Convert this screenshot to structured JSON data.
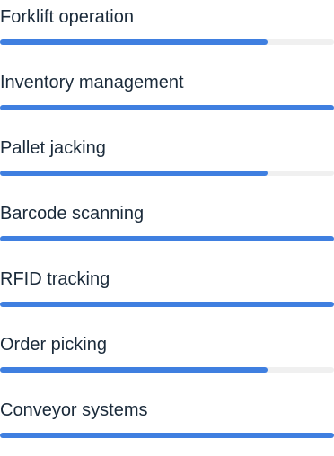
{
  "skills": [
    {
      "label": "Forklift operation",
      "level_percent": 80
    },
    {
      "label": "Inventory management",
      "level_percent": 100
    },
    {
      "label": "Pallet jacking",
      "level_percent": 80
    },
    {
      "label": "Barcode scanning",
      "level_percent": 100
    },
    {
      "label": "RFID tracking",
      "level_percent": 100
    },
    {
      "label": "Order picking",
      "level_percent": 80
    },
    {
      "label": "Conveyor systems",
      "level_percent": 100
    }
  ],
  "colors": {
    "fill": "#3f7fe0",
    "track": "#f0f0f0",
    "text": "#1a2a3a"
  }
}
